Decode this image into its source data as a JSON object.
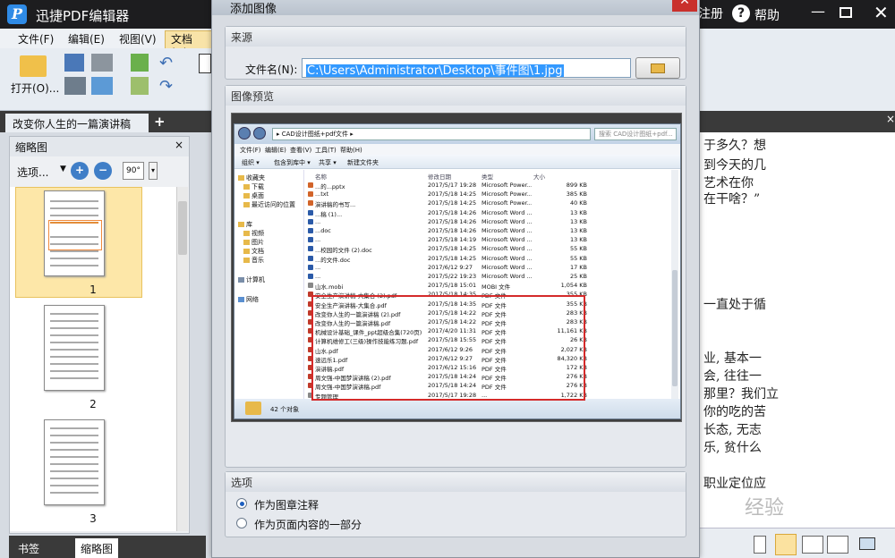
{
  "app": {
    "title": "迅捷PDF编辑器",
    "register": "注册",
    "help": "帮助",
    "logo_letter": "P"
  },
  "menu": [
    "文件(F)",
    "编辑(E)",
    "视图(V)",
    "文档(D)"
  ],
  "ribbon": {
    "open_label": "打开(O)..."
  },
  "doc_tab": "改变你人生的一篇演讲稿",
  "thumbs": {
    "title": "缩略图",
    "options": "选项...",
    "rotate": "90°",
    "pages": [
      "1",
      "2",
      "3"
    ]
  },
  "bottom_tabs": [
    "书签",
    "缩略图"
  ],
  "right_text": [
    "于多久？想",
    "到今天的几",
    "艺术在你",
    "在干啥？”",
    "一直处于循",
    "业, 基本一",
    "会, 往往一",
    "那里？我们立",
    "你的吃的苦",
    "长态, 无志",
    "乐, 贫什么",
    "职业定位应"
  ],
  "watermark": "经验",
  "dialog": {
    "title": "添加图像",
    "source_label": "来源",
    "filename_label": "文件名(N):",
    "filename_value": "C:\\Users\\Administrator\\Desktop\\事件图\\1.jpg",
    "preview_label": "图像预览",
    "options_label": "选项",
    "option1": "作为图章注释",
    "option2": "作为页面内容的一部分",
    "option_selected": 1
  },
  "explorer": {
    "address": "▸ CAD设计图纸+pdf文件 ▸",
    "search_placeholder": "搜索 CAD设计图纸+pdf...",
    "menu": [
      "文件(F)",
      "编辑(E)",
      "查看(V)",
      "工具(T)",
      "帮助(H)"
    ],
    "toolbar": [
      "组织 ▾",
      "包含到库中 ▾",
      "共享 ▾",
      "新建文件夹"
    ],
    "nav": [
      "收藏夹",
      "下载",
      "桌面",
      "最近访问的位置",
      "库",
      "视频",
      "图片",
      "文档",
      "音乐",
      "计算机",
      "网络"
    ],
    "columns": [
      "名称",
      "修改日期",
      "类型",
      "大小"
    ],
    "files": [
      {
        "name": "...的...pptx",
        "date": "2017/5/17 19:28",
        "type": "Microsoft Power...",
        "size": "899 KB"
      },
      {
        "name": "...txt",
        "date": "2017/5/18 14:25",
        "type": "Microsoft Power...",
        "size": "385 KB"
      },
      {
        "name": "演讲稿的书写...",
        "date": "2017/5/18 14:25",
        "type": "Microsoft Power...",
        "size": "40 KB"
      },
      {
        "name": "...稿 (1)...",
        "date": "2017/5/18 14:26",
        "type": "Microsoft Word ...",
        "size": "13 KB"
      },
      {
        "name": "...",
        "date": "2017/5/18 14:26",
        "type": "Microsoft Word ...",
        "size": "13 KB"
      },
      {
        "name": "...doc",
        "date": "2017/5/18 14:26",
        "type": "Microsoft Word ...",
        "size": "13 KB"
      },
      {
        "name": "...",
        "date": "2017/5/18 14:19",
        "type": "Microsoft Word ...",
        "size": "13 KB"
      },
      {
        "name": "...校园的文件 (2).doc",
        "date": "2017/5/18 14:25",
        "type": "Microsoft Word ...",
        "size": "55 KB"
      },
      {
        "name": "...的文件.doc",
        "date": "2017/5/18 14:25",
        "type": "Microsoft Word ...",
        "size": "55 KB"
      },
      {
        "name": "...",
        "date": "2017/6/12 9:27",
        "type": "Microsoft Word ...",
        "size": "17 KB"
      },
      {
        "name": "...",
        "date": "2017/5/22 19:23",
        "type": "Microsoft Word ...",
        "size": "25 KB"
      },
      {
        "name": "山水.mobi",
        "date": "2017/5/18 15:01",
        "type": "MOBI 文件",
        "size": "1,054 KB"
      },
      {
        "name": "安全生产演讲稿-大集合 (2).pdf",
        "date": "2017/5/18 14:35",
        "type": "PDF 文件",
        "size": "355 KB"
      },
      {
        "name": "安全生产演讲稿-大集合.pdf",
        "date": "2017/5/18 14:35",
        "type": "PDF 文件",
        "size": "355 KB"
      },
      {
        "name": "改变你人生的一篇演讲稿 (2).pdf",
        "date": "2017/5/18 14:22",
        "type": "PDF 文件",
        "size": "283 KB"
      },
      {
        "name": "改变你人生的一篇演讲稿.pdf",
        "date": "2017/5/18 14:22",
        "type": "PDF 文件",
        "size": "283 KB"
      },
      {
        "name": "机械设计基础_课件_ppt超级合集(720页)...",
        "date": "2017/4/20 11:31",
        "type": "PDF 文件",
        "size": "11,161 KB"
      },
      {
        "name": "计算机维修工(三级)操作技能练习题.pdf",
        "date": "2017/5/18 15:55",
        "type": "PDF 文件",
        "size": "26 KB"
      },
      {
        "name": "山水.pdf",
        "date": "2017/6/12 9:26",
        "type": "PDF 文件",
        "size": "2,027 KB"
      },
      {
        "name": "速远乐1.pdf",
        "date": "2017/6/12 9:27",
        "type": "PDF 文件",
        "size": "84,320 KB"
      },
      {
        "name": "演讲稿.pdf",
        "date": "2017/6/12 15:16",
        "type": "PDF 文件",
        "size": "172 KB"
      },
      {
        "name": "周文强-中国梦演讲稿 (2).pdf",
        "date": "2017/5/18 14:24",
        "type": "PDF 文件",
        "size": "276 KB"
      },
      {
        "name": "周文强-中国梦演讲稿.pdf",
        "date": "2017/5/18 14:24",
        "type": "PDF 文件",
        "size": "276 KB"
      },
      {
        "name": "专题管理",
        "date": "2017/5/17 19:28",
        "type": "...",
        "size": "1,722 KB"
      }
    ],
    "status": "42 个对象"
  },
  "colors": {
    "accent": "#2f8be6",
    "highlight": "#d42a2a",
    "selection": "#3399ff"
  }
}
